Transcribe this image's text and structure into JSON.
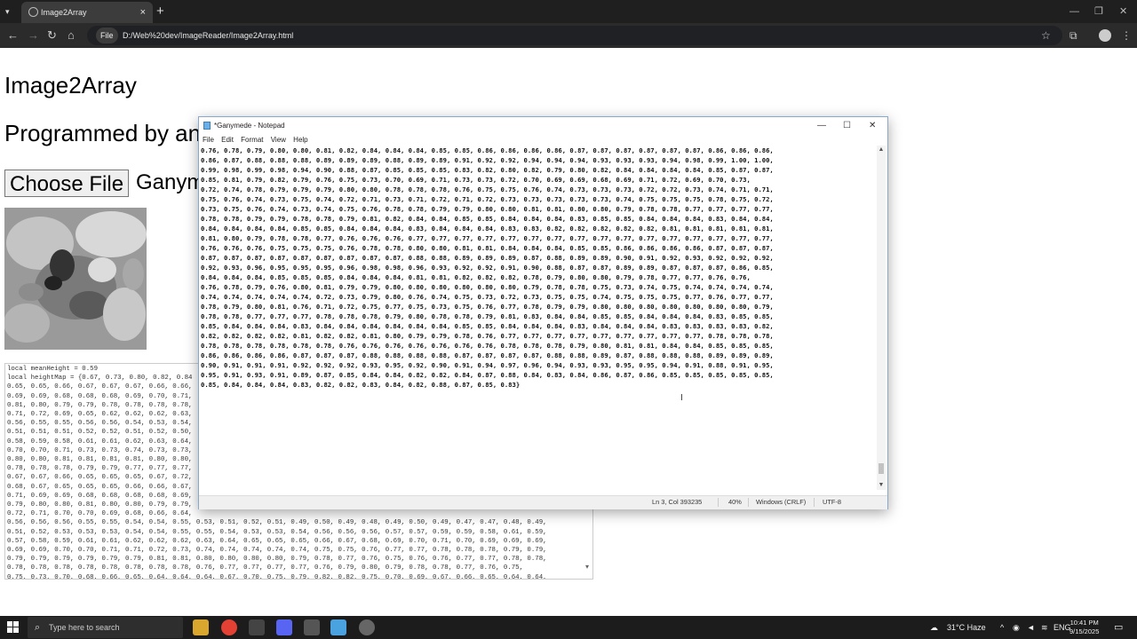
{
  "browser": {
    "tab_title": "Image2Array",
    "tab_close": "×",
    "new_tab": "+",
    "file_chip": "File",
    "url": "D:/Web%20dev/ImageReader/Image2Array.html"
  },
  "page": {
    "title": "Image2Array",
    "programmed_by": "Programmed by an",
    "choose_file_label": "Choose File",
    "selected_file": "Ganym",
    "output_lines": [
      "local meanHeight = 0.59",
      "local heightMap = {0.67, 0.73, 0.80, 0.82, 0.84",
      "0.65, 0.65, 0.66, 0.67, 0.67, 0.67, 0.66, 0.66,",
      "0.69, 0.69, 0.68, 0.68, 0.68, 0.69, 0.70, 0.71,",
      "0.81, 0.80, 0.79, 0.79, 0.78, 0.78, 0.78, 0.78,",
      "0.71, 0.72, 0.69, 0.65, 0.62, 0.62, 0.62, 0.63,",
      "0.56, 0.55, 0.55, 0.56, 0.56, 0.54, 0.53, 0.54,",
      "0.51, 0.51, 0.51, 0.52, 0.52, 0.51, 0.52, 0.50,",
      "0.58, 0.59, 0.58, 0.61, 0.61, 0.62, 0.63, 0.64,",
      "0.70, 0.70, 0.71, 0.73, 0.73, 0.74, 0.73, 0.73,",
      "0.80, 0.80, 0.81, 0.81, 0.81, 0.81, 0.80, 0.80,",
      "0.78, 0.78, 0.78, 0.79, 0.79, 0.77, 0.77, 0.77,",
      "0.67, 0.67, 0.66, 0.65, 0.65, 0.65, 0.67, 0.72,",
      "0.68, 0.67, 0.65, 0.65, 0.65, 0.66, 0.66, 0.67,",
      "0.71, 0.69, 0.69, 0.68, 0.68, 0.68, 0.68, 0.69,",
      "0.79, 0.80, 0.80, 0.81, 0.80, 0.80, 0.79, 0.79,",
      "0.72, 0.71, 0.70, 0.70, 0.69, 0.68, 0.66, 0.64,",
      "0.56, 0.56, 0.56, 0.55, 0.55, 0.54, 0.54, 0.55, 0.53, 0.51, 0.52, 0.51, 0.49, 0.50, 0.49, 0.48, 0.49, 0.50, 0.49, 0.47, 0.47, 0.48, 0.49,",
      "0.51, 0.52, 0.53, 0.53, 0.53, 0.54, 0.54, 0.55, 0.55, 0.54, 0.53, 0.53, 0.54, 0.56, 0.56, 0.56, 0.57, 0.57, 0.59, 0.59, 0.58, 0.61, 0.59,",
      "0.57, 0.58, 0.59, 0.61, 0.61, 0.62, 0.62, 0.62, 0.63, 0.64, 0.65, 0.65, 0.65, 0.66, 0.67, 0.68, 0.69, 0.70, 0.71, 0.70, 0.69, 0.69, 0.69,",
      "0.69, 0.69, 0.70, 0.70, 0.71, 0.71, 0.72, 0.73, 0.74, 0.74, 0.74, 0.74, 0.74, 0.75, 0.75, 0.76, 0.77, 0.77, 0.78, 0.78, 0.78, 0.79, 0.79,",
      "0.79, 0.79, 0.79, 0.79, 0.79, 0.79, 0.81, 0.81, 0.80, 0.80, 0.80, 0.80, 0.79, 0.78, 0.77, 0.76, 0.75, 0.76, 0.76, 0.77, 0.77, 0.78, 0.78,",
      "0.78, 0.78, 0.78, 0.78, 0.78, 0.78, 0.78, 0.78, 0.76, 0.77, 0.77, 0.77, 0.77, 0.76, 0.79, 0.80, 0.79, 0.78, 0.78, 0.77, 0.76, 0.75,",
      "0.75, 0.73, 0.70, 0.68, 0.66, 0.65, 0.64, 0.64, 0.64, 0.67, 0.70, 0.75, 0.79, 0.82, 0.82, 0.75, 0.70, 0.69, 0.67, 0.66, 0.65, 0.64, 0.64,",
      "0.63, 0.63, 0.62, 0.62, 0.62, 0.64, 0.64, 0.65, 0.65, 0.66, 0.66, 0.67, 0.66, 0.66, 0.67, 0.67, 0.68, 0.69, 0.68, 0.68, 0.67, 0.67, 0.67,"
    ]
  },
  "notepad": {
    "title": "*Ganymede - Notepad",
    "menu": [
      "File",
      "Edit",
      "Format",
      "View",
      "Help"
    ],
    "lines": [
      "0.76, 0.78, 0.79, 0.80, 0.80, 0.81, 0.82, 0.84, 0.84, 0.84, 0.85, 0.85, 0.86, 0.86, 0.86, 0.86, 0.87, 0.87, 0.87, 0.87, 0.87, 0.87, 0.86, 0.86, 0.86,",
      "0.86, 0.87, 0.88, 0.88, 0.88, 0.89, 0.89, 0.89, 0.88, 0.89, 0.89, 0.91, 0.92, 0.92, 0.94, 0.94, 0.94, 0.93, 0.93, 0.93, 0.94, 0.98, 0.99, 1.00, 1.00,",
      "0.99, 0.98, 0.99, 0.98, 0.94, 0.90, 0.88, 0.87, 0.85, 0.85, 0.85, 0.83, 0.82, 0.80, 0.82, 0.79, 0.80, 0.82, 0.84, 0.84, 0.84, 0.84, 0.85, 0.87, 0.87,",
      "0.85, 0.81, 0.79, 0.82, 0.79, 0.76, 0.75, 0.73, 0.70, 0.69, 0.71, 0.73, 0.73, 0.72, 0.70, 0.69, 0.69, 0.68, 0.69, 0.71, 0.72, 0.69, 0.70, 0.73,",
      "0.72, 0.74, 0.78, 0.79, 0.79, 0.79, 0.80, 0.80, 0.78, 0.78, 0.78, 0.76, 0.75, 0.75, 0.76, 0.74, 0.73, 0.73, 0.73, 0.72, 0.72, 0.73, 0.74, 0.71, 0.71,",
      "0.75, 0.76, 0.74, 0.73, 0.75, 0.74, 0.72, 0.71, 0.73, 0.71, 0.72, 0.71, 0.72, 0.73, 0.73, 0.73, 0.73, 0.73, 0.74, 0.75, 0.75, 0.75, 0.78, 0.75, 0.72,",
      "0.73, 0.75, 0.76, 0.74, 0.73, 0.74, 0.75, 0.76, 0.78, 0.78, 0.79, 0.79, 0.80, 0.80, 0.81, 0.81, 0.80, 0.80, 0.79, 0.78, 0.78, 0.77, 0.77, 0.77, 0.77,",
      "0.78, 0.78, 0.79, 0.79, 0.78, 0.78, 0.79, 0.81, 0.82, 0.84, 0.84, 0.85, 0.85, 0.84, 0.84, 0.84, 0.83, 0.85, 0.85, 0.84, 0.84, 0.84, 0.83, 0.84, 0.84,",
      "0.84, 0.84, 0.84, 0.84, 0.85, 0.85, 0.84, 0.84, 0.84, 0.83, 0.84, 0.84, 0.84, 0.83, 0.83, 0.82, 0.82, 0.82, 0.82, 0.82, 0.81, 0.81, 0.81, 0.81, 0.81,",
      "0.81, 0.80, 0.79, 0.78, 0.78, 0.77, 0.76, 0.76, 0.76, 0.77, 0.77, 0.77, 0.77, 0.77, 0.77, 0.77, 0.77, 0.77, 0.77, 0.77, 0.77, 0.77, 0.77, 0.77, 0.77,",
      "0.76, 0.76, 0.76, 0.75, 0.75, 0.75, 0.76, 0.78, 0.78, 0.80, 0.80, 0.81, 0.81, 0.84, 0.84, 0.84, 0.85, 0.85, 0.86, 0.86, 0.86, 0.86, 0.87, 0.87, 0.87,",
      "0.87, 0.87, 0.87, 0.87, 0.87, 0.87, 0.87, 0.87, 0.87, 0.88, 0.88, 0.89, 0.89, 0.89, 0.87, 0.88, 0.89, 0.89, 0.90, 0.91, 0.92, 0.93, 0.92, 0.92, 0.92,",
      "0.92, 0.93, 0.96, 0.95, 0.95, 0.95, 0.96, 0.98, 0.98, 0.96, 0.93, 0.92, 0.92, 0.91, 0.90, 0.88, 0.87, 0.87, 0.89, 0.89, 0.87, 0.87, 0.87, 0.86, 0.85,",
      "0.84, 0.84, 0.84, 0.85, 0.85, 0.85, 0.84, 0.84, 0.84, 0.81, 0.81, 0.82, 0.82, 0.82, 0.78, 0.79, 0.80, 0.80, 0.79, 0.78, 0.77, 0.77, 0.76, 0.76,",
      "0.76, 0.78, 0.79, 0.76, 0.80, 0.81, 0.79, 0.79, 0.80, 0.80, 0.80, 0.80, 0.80, 0.80, 0.79, 0.78, 0.78, 0.75, 0.73, 0.74, 0.75, 0.74, 0.74, 0.74, 0.74,",
      "0.74, 0.74, 0.74, 0.74, 0.74, 0.72, 0.73, 0.79, 0.80, 0.76, 0.74, 0.75, 0.73, 0.72, 0.73, 0.75, 0.75, 0.74, 0.75, 0.75, 0.75, 0.77, 0.76, 0.77, 0.77,",
      "0.78, 0.79, 0.80, 0.81, 0.76, 0.71, 0.72, 0.75, 0.77, 0.75, 0.73, 0.75, 0.76, 0.77, 0.78, 0.79, 0.79, 0.80, 0.80, 0.80, 0.80, 0.80, 0.80, 0.80, 0.79,",
      "0.78, 0.78, 0.77, 0.77, 0.77, 0.78, 0.78, 0.78, 0.79, 0.80, 0.78, 0.78, 0.79, 0.81, 0.83, 0.84, 0.84, 0.85, 0.85, 0.84, 0.84, 0.84, 0.83, 0.85, 0.85,",
      "0.85, 0.84, 0.84, 0.84, 0.83, 0.84, 0.84, 0.84, 0.84, 0.84, 0.84, 0.85, 0.85, 0.84, 0.84, 0.84, 0.83, 0.84, 0.84, 0.84, 0.83, 0.83, 0.83, 0.83, 0.82,",
      "0.82, 0.82, 0.82, 0.82, 0.81, 0.82, 0.82, 0.81, 0.80, 0.79, 0.79, 0.78, 0.76, 0.77, 0.77, 0.77, 0.77, 0.77, 0.77, 0.77, 0.77, 0.77, 0.78, 0.78, 0.78,",
      "0.78, 0.78, 0.78, 0.78, 0.78, 0.78, 0.76, 0.76, 0.76, 0.76, 0.76, 0.76, 0.76, 0.78, 0.78, 0.78, 0.79, 0.80, 0.81, 0.81, 0.84, 0.84, 0.85, 0.85, 0.85,",
      "0.86, 0.86, 0.86, 0.86, 0.87, 0.87, 0.87, 0.88, 0.88, 0.88, 0.88, 0.87, 0.87, 0.87, 0.87, 0.88, 0.88, 0.89, 0.87, 0.88, 0.88, 0.88, 0.89, 0.89, 0.89,",
      "0.90, 0.91, 0.91, 0.91, 0.92, 0.92, 0.92, 0.93, 0.95, 0.92, 0.90, 0.91, 0.94, 0.97, 0.96, 0.94, 0.93, 0.93, 0.95, 0.95, 0.94, 0.91, 0.88, 0.91, 0.95,",
      "0.95, 0.91, 0.93, 0.91, 0.89, 0.87, 0.85, 0.84, 0.84, 0.82, 0.82, 0.84, 0.87, 0.88, 0.84, 0.83, 0.84, 0.86, 0.87, 0.86, 0.85, 0.85, 0.85, 0.85, 0.85,",
      "0.85, 0.84, 0.84, 0.84, 0.83, 0.82, 0.82, 0.83, 0.84, 0.82, 0.88, 0.87, 0.85, 0.83}"
    ],
    "status": {
      "position": "Ln 3, Col 393235",
      "zoom": "40%",
      "line_ending": "Windows (CRLF)",
      "encoding": "UTF-8"
    }
  },
  "taskbar": {
    "search_placeholder": "Type here to search",
    "weather": "31°C Haze",
    "language": "ENG",
    "time": "10:41 PM",
    "date": "9/15/2025"
  },
  "colors": {
    "browser_chrome": "#1f1f1f",
    "taskbar": "#1c1c1c",
    "notepad_border": "#8aa8c8"
  }
}
